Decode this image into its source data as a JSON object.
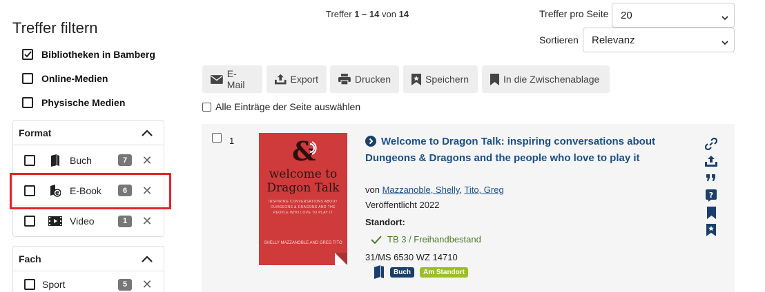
{
  "sidebar": {
    "title": "Treffer filtern",
    "top_filters": [
      {
        "label": "Bibliotheken in Bamberg",
        "checked": true
      },
      {
        "label": "Online-Medien",
        "checked": false
      },
      {
        "label": "Physische Medien",
        "checked": false
      }
    ],
    "format": {
      "heading": "Format",
      "items": [
        {
          "label": "Buch",
          "count": "7",
          "icon": "book-icon"
        },
        {
          "label": "E-Book",
          "count": "6",
          "icon": "ebook-icon"
        },
        {
          "label": "Video",
          "count": "1",
          "icon": "video-icon"
        }
      ]
    },
    "fach": {
      "heading": "Fach",
      "items": [
        {
          "label": "Sport",
          "count": "5"
        }
      ]
    },
    "remove_glyph": "✕"
  },
  "header": {
    "hits_prefix": "Treffer",
    "hits_range": "1 – 14",
    "hits_of": "von",
    "hits_total": "14",
    "per_page_label": "Treffer pro Seite",
    "per_page_value": "20",
    "sort_label": "Sortieren",
    "sort_value": "Relevanz"
  },
  "toolbar": {
    "email": "E-Mail",
    "export": "Export",
    "print": "Drucken",
    "save": "Speichern",
    "clipboard": "In die Zwischenablage"
  },
  "select_all": "Alle Einträge der Seite auswählen",
  "result": {
    "number": "1",
    "title": "Welcome to Dragon Talk: inspiring conversations about Dungeons & Dragons and the people who love to play it",
    "author_prefix": "von",
    "authors": [
      "Mazzanoble, Shelly",
      "Tito, Greg"
    ],
    "author_sep": ", ",
    "published": "Veröffentlicht 2022",
    "location_heading": "Standort:",
    "location": "TB 3 / Freihandbestand",
    "signature": "31/MS 6530 WZ 14710",
    "badge_type": "Buch",
    "badge_status": "Am Standort",
    "cover": {
      "title_line1": "welcome to",
      "title_line2": "Dragon Talk",
      "subtitle": "INSPIRING CONVERSATIONS ABOUT DUNGEONS & DRAGONS AND THE PEOPLE WHO LOVE TO PLAY IT",
      "authors": "SHELLY MAZZANOBLE AND GREG TITO"
    },
    "actions": [
      "link-icon",
      "export-icon",
      "cite-icon",
      "help-icon",
      "bookmark-icon",
      "bookmark-star-icon"
    ]
  },
  "colors": {
    "link": "#1a4f8a",
    "highlight": "#e32228",
    "badge_type": "#1a3f6b",
    "badge_status": "#9bbf25",
    "location": "#4a7a2a"
  }
}
